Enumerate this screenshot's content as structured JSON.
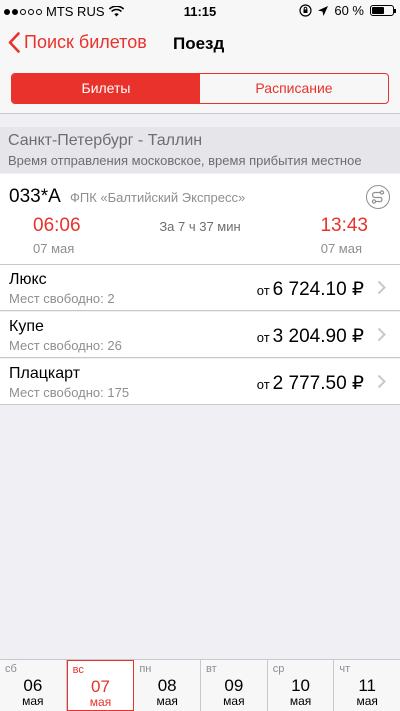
{
  "status": {
    "carrier": "MTS RUS",
    "time": "11:15",
    "battery": "60 %"
  },
  "nav": {
    "back_label": "Поиск билетов",
    "title": "Поезд"
  },
  "tabs": [
    {
      "label": "Билеты"
    },
    {
      "label": "Расписание"
    }
  ],
  "route": {
    "title": "Санкт-Петербург - Таллин",
    "note": "Время отправления московское, время прибытия местное"
  },
  "train": {
    "number": "033*А",
    "name": "ФПК «Балтийский Экспресс»",
    "departure_time": "06:06",
    "departure_date": "07 мая",
    "duration": "За 7 ч 37 мин",
    "arrival_time": "13:43",
    "arrival_date": "07 мая"
  },
  "classes": [
    {
      "name": "Люкс",
      "seats": "Мест свободно: 2",
      "from": "от",
      "price": "6 724.10 ₽"
    },
    {
      "name": "Купе",
      "seats": "Мест свободно: 26",
      "from": "от",
      "price": "3 204.90 ₽"
    },
    {
      "name": "Плацкарт",
      "seats": "Мест свободно: 175",
      "from": "от",
      "price": "2 777.50 ₽"
    }
  ],
  "dates": [
    {
      "weekday": "сб",
      "day": "06",
      "month": "мая"
    },
    {
      "weekday": "вс",
      "day": "07",
      "month": "мая"
    },
    {
      "weekday": "пн",
      "day": "08",
      "month": "мая"
    },
    {
      "weekday": "вт",
      "day": "09",
      "month": "мая"
    },
    {
      "weekday": "ср",
      "day": "10",
      "month": "мая"
    },
    {
      "weekday": "чт",
      "day": "11",
      "month": "мая"
    }
  ],
  "colors": {
    "accent": "#e8322b"
  }
}
